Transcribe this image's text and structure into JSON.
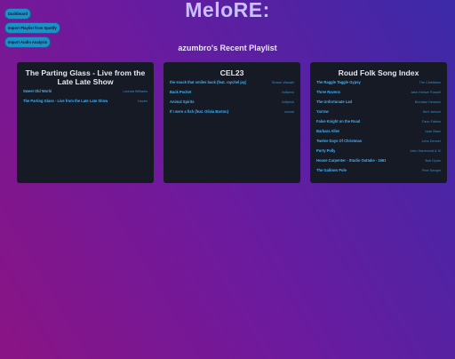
{
  "app": {
    "title": "MeloRE:"
  },
  "nav": {
    "buttons": [
      {
        "label": "Dashboard"
      },
      {
        "label": "Import Playlist from Spotify"
      },
      {
        "label": "Import Audio Analysis"
      }
    ]
  },
  "section": {
    "title": "azumbro's Recent Playlist"
  },
  "playlists": [
    {
      "title": "The Parting Glass - Live from the Late Late Show",
      "tracks": [
        {
          "name": "Sweet Old World",
          "artist": "Lucinda Williams"
        },
        {
          "name": "The Parting Glass - Live from the Late Late Show",
          "artist": "Hozier"
        }
      ]
    },
    {
      "title": "CEL23",
      "tracks": [
        {
          "name": "the snack that smiles back (feat. raychel jay)",
          "artist": "Shawn Wasabi"
        },
        {
          "name": "Back Pocket",
          "artist": "Vulfpeck"
        },
        {
          "name": "Animal Spirits",
          "artist": "Vulfpeck"
        },
        {
          "name": "If I were a fish (feat. Olivia Barton)",
          "artist": "corook"
        }
      ]
    },
    {
      "title": "Roud Folk Song Index",
      "tracks": [
        {
          "name": "The Raggle Taggle Gypsy",
          "artist": "The Chieftains"
        },
        {
          "name": "Three Ravens",
          "artist": "Jake Heinze Fussell"
        },
        {
          "name": "The Unfortunate Lad",
          "artist": "Brendan Dewson"
        },
        {
          "name": "Yarrow",
          "artist": "Bert Jansch"
        },
        {
          "name": "False Knight on the Road",
          "artist": "Faun Fables"
        },
        {
          "name": "Barbara Allen",
          "artist": "Joan Baez"
        },
        {
          "name": "Twelve Days Of Christmas",
          "artist": "John Denver"
        },
        {
          "name": "Purty Polly",
          "artist": "John Hammond & Ki"
        },
        {
          "name": "House Carpenter - Studio Outtake - 1961",
          "artist": "Bob Dylan"
        },
        {
          "name": "The Gallows Pole",
          "artist": "Pete Seeger"
        }
      ]
    }
  ]
}
